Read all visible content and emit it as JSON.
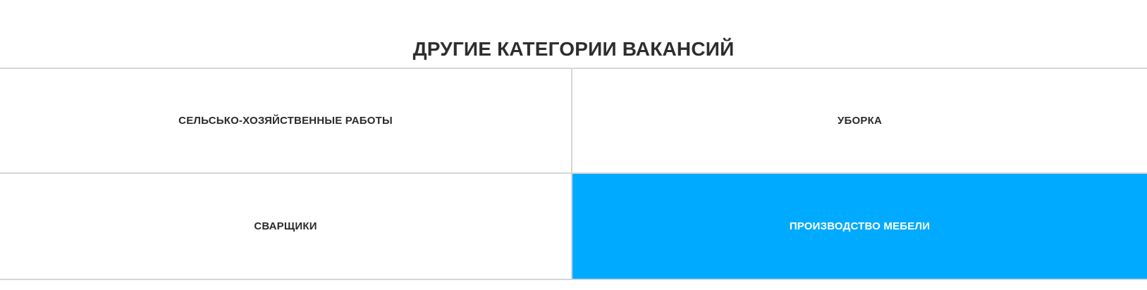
{
  "section": {
    "title": "ДРУГИЕ КАТЕГОРИИ ВАКАНСИЙ"
  },
  "categories": [
    {
      "label": "СЕЛЬСЬКО-ХОЗЯЙСТВЕННЫЕ РАБОТЫ",
      "active": false
    },
    {
      "label": "УБОРКА",
      "active": false
    },
    {
      "label": "СВАРЩИКИ",
      "active": false
    },
    {
      "label": "ПРОИЗВОДСТВО МЕБЕЛИ",
      "active": true
    }
  ],
  "colors": {
    "accent": "#00aaff",
    "text": "#2b2b2b",
    "border": "#d6d6d6",
    "active_text": "#ffffff"
  }
}
